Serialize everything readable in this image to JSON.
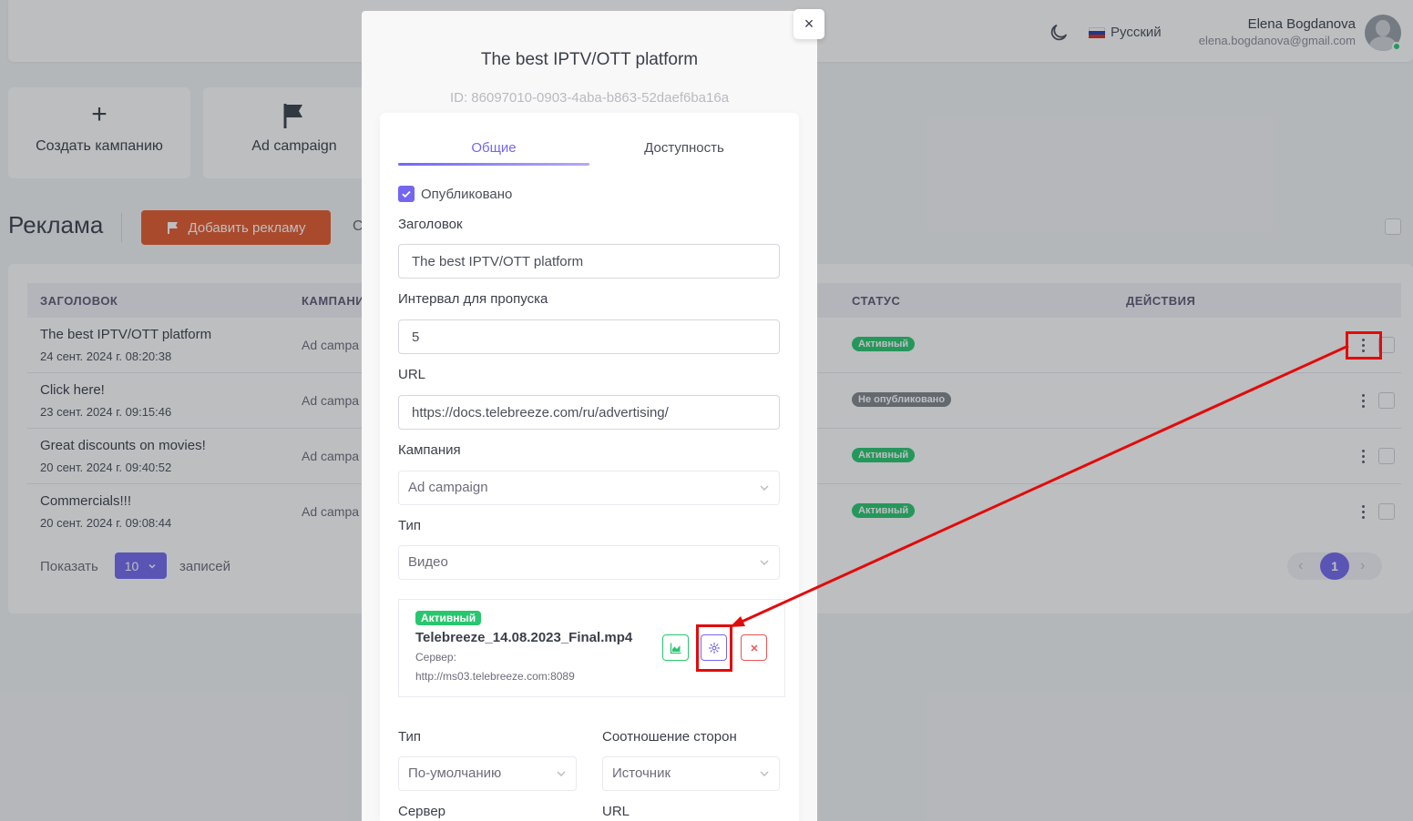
{
  "header": {
    "language": "Русский",
    "user_name": "Elena Bogdanova",
    "user_email": "elena.bogdanova@gmail.com"
  },
  "tiles": [
    {
      "label": "Создать кампанию",
      "icon": "plus-icon"
    },
    {
      "label": "Ad campaign",
      "icon": "flag-icon"
    }
  ],
  "page": {
    "title": "Реклама",
    "add_button": "Добавить рекламу",
    "partial_text": "С"
  },
  "table": {
    "columns": [
      "ЗАГОЛОВОК",
      "КАМПАНИ",
      "СТАТУС",
      "ДЕЙСТВИЯ"
    ],
    "rows": [
      {
        "title": "The best IPTV/OTT platform",
        "date": "24 сент. 2024 г. 08:20:38",
        "campaign": "Ad campa",
        "status": "Активный",
        "status_color": "#28c76f"
      },
      {
        "title": "Click here!",
        "date": "23 сент. 2024 г. 09:15:46",
        "campaign": "Ad campa",
        "status": "Не опубликовано",
        "status_color": "#82868b"
      },
      {
        "title": "Great discounts on movies!",
        "date": "20 сент. 2024 г. 09:40:52",
        "campaign": "Ad campa",
        "status": "Активный",
        "status_color": "#28c76f"
      },
      {
        "title": "Commercials!!!",
        "date": "20 сент. 2024 г. 09:08:44",
        "campaign": "Ad campa",
        "status": "Активный",
        "status_color": "#28c76f"
      }
    ],
    "show_label": "Показать",
    "per_page": "10",
    "records_label": "записей",
    "current_page": "1"
  },
  "modal": {
    "close": "×",
    "title": "The best IPTV/OTT platform",
    "id": "ID: 86097010-0903-4aba-b863-52daef6ba16a",
    "tabs": [
      "Общие",
      "Доступность"
    ],
    "published_label": "Опубликовано",
    "fields": {
      "title_label": "Заголовок",
      "title_value": "The best IPTV/OTT platform",
      "skip_label": "Интервал для пропуска",
      "skip_value": "5",
      "url_label": "URL",
      "url_value": "https://docs.telebreeze.com/ru/advertising/",
      "campaign_label": "Кампания",
      "campaign_value": "Ad campaign",
      "type_label": "Тип",
      "type_value": "Видео"
    },
    "media": {
      "status": "Активный",
      "file": "Telebreeze_14.08.2023_Final.mp4",
      "server_label": "Сервер:",
      "server_url": "http://ms03.telebreeze.com:8089"
    },
    "lower": {
      "type_label": "Тип",
      "type_value": "По-умолчанию",
      "aspect_label": "Соотношение сторон",
      "aspect_value": "Источник",
      "server_label": "Сервер",
      "url_label": "URL"
    }
  },
  "colors": {
    "primary": "#7367f0",
    "success": "#28c76f",
    "danger": "#ea5455",
    "accent": "#e5592c",
    "highlight": "#e20b0b"
  }
}
